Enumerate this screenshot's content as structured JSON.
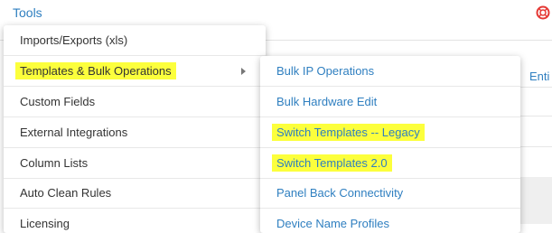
{
  "header": {
    "tools_label": "Tools",
    "help_icon": "lifebuoy-icon",
    "help_color": "#e53935"
  },
  "background": {
    "entity_link_partial": "Enti"
  },
  "tools_menu": {
    "items": [
      {
        "label": "Imports/Exports (xls)"
      },
      {
        "label": "Templates & Bulk Operations",
        "highlighted": true,
        "has_submenu": true
      },
      {
        "label": "Custom Fields"
      },
      {
        "label": "External Integrations"
      },
      {
        "label": "Column Lists"
      },
      {
        "label": "Auto Clean Rules"
      },
      {
        "label": "Licensing"
      }
    ]
  },
  "templates_submenu": {
    "items": [
      {
        "label": "Bulk IP Operations"
      },
      {
        "label": "Bulk Hardware Edit"
      },
      {
        "label": "Switch Templates -- Legacy",
        "highlighted": true
      },
      {
        "label": "Switch Templates 2.0",
        "highlighted": true
      },
      {
        "label": "Panel Back Connectivity"
      },
      {
        "label": "Device Name Profiles"
      }
    ]
  },
  "colors": {
    "link": "#2f7fc0",
    "highlight": "#fcff3c"
  }
}
